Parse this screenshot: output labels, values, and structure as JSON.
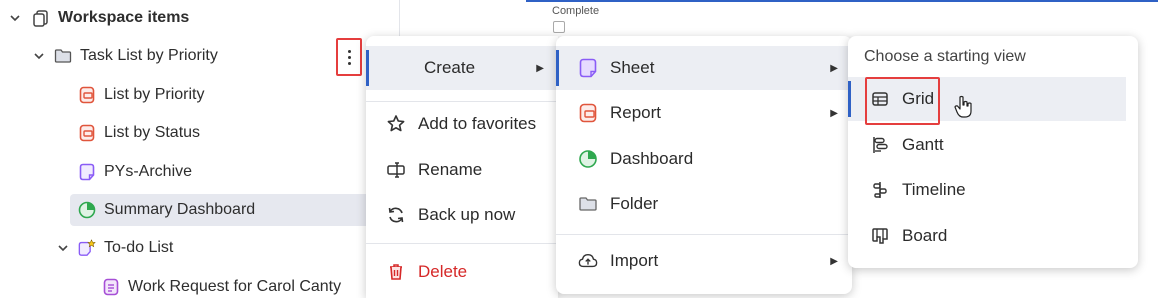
{
  "sidebar": {
    "workspace_label": "Workspace items",
    "folder_label": "Task List by Priority",
    "items": [
      {
        "label": "List by Priority",
        "icon": "report-icon"
      },
      {
        "label": "List by Status",
        "icon": "report-icon"
      },
      {
        "label": "PYs-Archive",
        "icon": "sheet-icon"
      },
      {
        "label": "Summary Dashboard",
        "icon": "dashboard-icon"
      },
      {
        "label": "To-do List",
        "icon": "favorite-sheet-icon"
      },
      {
        "label": "Work Request for Carol Canty",
        "icon": "form-icon"
      }
    ]
  },
  "sheet": {
    "column_label": "Complete"
  },
  "context_menu": {
    "create": "Create",
    "add_to_favorites": "Add to favorites",
    "rename": "Rename",
    "back_up_now": "Back up now",
    "delete": "Delete"
  },
  "create_menu": {
    "sheet": "Sheet",
    "report": "Report",
    "dashboard": "Dashboard",
    "folder": "Folder",
    "import": "Import"
  },
  "view_menu": {
    "header": "Choose a starting view",
    "grid": "Grid",
    "gantt": "Gantt",
    "timeline": "Timeline",
    "board": "Board"
  },
  "colors": {
    "accent": "#2f61c5",
    "highlight": "#e53e3e",
    "delete": "#d62828",
    "report": "#e0553c",
    "sheet": "#8a5cf6",
    "dashboard": "#2fa84f"
  }
}
